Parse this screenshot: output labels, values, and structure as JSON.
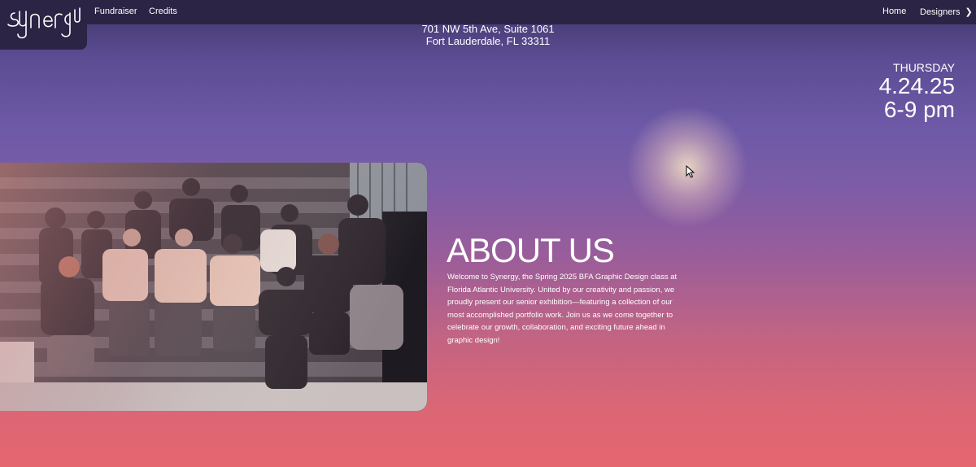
{
  "nav": {
    "logo_text": "synergy",
    "links_left": [
      "Fundraiser",
      "Credits"
    ],
    "links_right": [
      "Home",
      "Designers"
    ],
    "designers_chevron": "chevron-right-icon"
  },
  "address": {
    "line1": "701 NW 5th Ave, Suite 1061",
    "line2": "Fort Lauderdale, FL 33311"
  },
  "event": {
    "day": "THURSDAY",
    "date": "4.24.25",
    "time": "6-9 pm"
  },
  "about": {
    "heading": "ABOUT US",
    "body": "Welcome to Synergy, the Spring 2025 BFA Graphic Design class at Florida Atlantic University. United by our creativity and passion, we proudly present our senior exhibition—featuring a collection of our most accomplished portfolio work. Join us as we come together to celebrate our growth, collaboration, and exciting future ahead in graphic design!"
  },
  "colors": {
    "nav_bg": "#2b2444",
    "gradient_top": "#5b4c92",
    "gradient_bottom": "#e6666f",
    "text": "#ffffff"
  }
}
